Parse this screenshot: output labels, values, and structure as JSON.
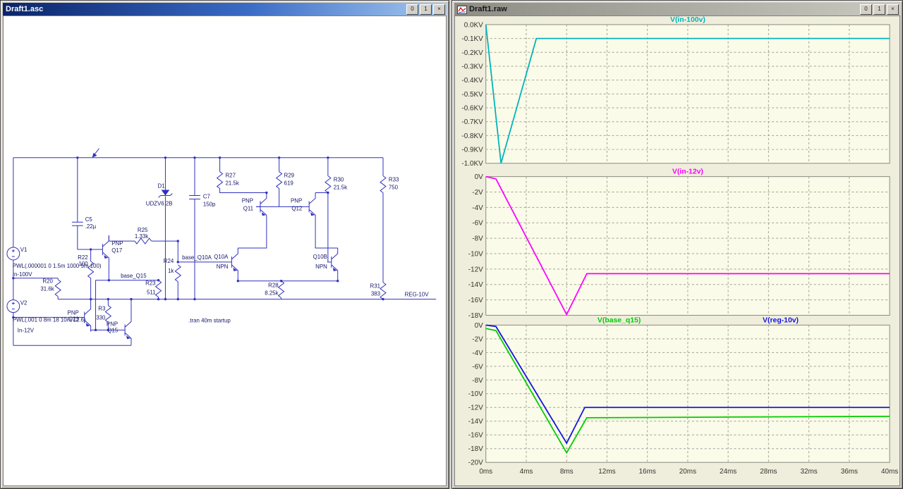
{
  "left_window": {
    "title": "Draft1.asc",
    "buttons": [
      "0",
      "1",
      "×"
    ]
  },
  "right_window": {
    "title": "Draft1.raw",
    "buttons": [
      "0",
      "1",
      "×"
    ]
  },
  "schematic": {
    "directive": ".tran 40m startup",
    "labels": {
      "v1_name": "V1",
      "v1_value": "PWL(.000001 0 1.5m 1000 5m 100)",
      "net_in100": "In-100V",
      "r20_name": "R20",
      "r20_value": "31.6k",
      "v2_name": "V2",
      "v2_value": "PWL(.001 0 8m 18 10m 12.6)",
      "net_in12": "In-12V",
      "c5_name": "C5",
      "c5_value": ".22µ",
      "r22_name": "R22",
      "r22_value": "100",
      "q17_type": "PNP",
      "q17_name": "Q17",
      "r25_name": "R25",
      "r25_value": "1.33k",
      "d1_name": "D1",
      "d1_value": "UDZV6 2B",
      "c7_name": "C7",
      "c7_value": "150p",
      "r27_name": "R27",
      "r27_value": "21.5k",
      "r29_name": "R29",
      "r29_value": "619",
      "q11_type": "PNP",
      "q11_name": "Q11",
      "q12_type": "PNP",
      "q12_name": "Q12",
      "r30_name": "R30",
      "r30_value": "21.5k",
      "r33_name": "R33",
      "r33_value": "750",
      "r24_name": "R24",
      "r24_value": "1k",
      "net_base_q10a": "base_Q10A",
      "q10a_name": "Q10A",
      "q10a_type": "NPN",
      "net_base_q15": "base_Q15",
      "r23_name": "R23",
      "r23_value": "511",
      "r28_name": "R28",
      "r28_value": "8.25k",
      "q10b_name": "Q10B",
      "q10b_type": "NPN",
      "r31_name": "R31",
      "r31_value": "383",
      "net_reg10": "REG-10V",
      "q23_type": "PNP",
      "q23_name": "Q23",
      "r3_name": "R3",
      "r3_value": "330",
      "q15_type": "PNP",
      "q15_name": "Q15"
    }
  },
  "chart_data": [
    {
      "type": "line",
      "title": "V(in-100v)",
      "xlim_ms": [
        0,
        40
      ],
      "ylim_V": [
        -1000,
        0
      ],
      "grid": true,
      "y_ticks": [
        "0.0KV",
        "-0.1KV",
        "-0.2KV",
        "-0.3KV",
        "-0.4KV",
        "-0.5KV",
        "-0.6KV",
        "-0.7KV",
        "-0.8KV",
        "-0.9KV",
        "-1.0KV"
      ],
      "series": [
        {
          "name": "V(in-100v)",
          "color": "#00b4b8",
          "points": [
            [
              0,
              0
            ],
            [
              1.5,
              -1000
            ],
            [
              5,
              -100
            ],
            [
              40,
              -100
            ]
          ]
        }
      ]
    },
    {
      "type": "line",
      "title": "V(in-12v)",
      "xlim_ms": [
        0,
        40
      ],
      "ylim_V": [
        -18,
        0
      ],
      "grid": true,
      "y_ticks": [
        "0V",
        "-2V",
        "-4V",
        "-6V",
        "-8V",
        "-10V",
        "-12V",
        "-14V",
        "-16V",
        "-18V"
      ],
      "series": [
        {
          "name": "V(in-12v)",
          "color": "#ff00ff",
          "points": [
            [
              0,
              0
            ],
            [
              1,
              -0.3
            ],
            [
              8,
              -17.9
            ],
            [
              10,
              -12.6
            ],
            [
              40,
              -12.6
            ]
          ]
        }
      ]
    },
    {
      "type": "line",
      "title": "V(base_q15) / V(reg-10v)",
      "xlim_ms": [
        0,
        40
      ],
      "ylim_V": [
        -20,
        0
      ],
      "grid": true,
      "y_ticks": [
        "0V",
        "-2V",
        "-4V",
        "-6V",
        "-8V",
        "-10V",
        "-12V",
        "-14V",
        "-16V",
        "-18V",
        "-20V"
      ],
      "x_ticks": [
        "0ms",
        "4ms",
        "8ms",
        "12ms",
        "16ms",
        "20ms",
        "24ms",
        "28ms",
        "32ms",
        "36ms",
        "40ms"
      ],
      "series": [
        {
          "name": "V(base_q15)",
          "color": "#00cc00",
          "points": [
            [
              0,
              -0.5
            ],
            [
              1,
              -0.8
            ],
            [
              8,
              -18.6
            ],
            [
              10,
              -13.5
            ],
            [
              24,
              -13.4
            ],
            [
              40,
              -13.3
            ]
          ]
        },
        {
          "name": "V(reg-10v)",
          "color": "#1414e0",
          "points": [
            [
              0,
              0
            ],
            [
              1,
              -0.2
            ],
            [
              8,
              -17.2
            ],
            [
              9.8,
              -12.0
            ],
            [
              40,
              -12.0
            ]
          ]
        }
      ]
    }
  ]
}
